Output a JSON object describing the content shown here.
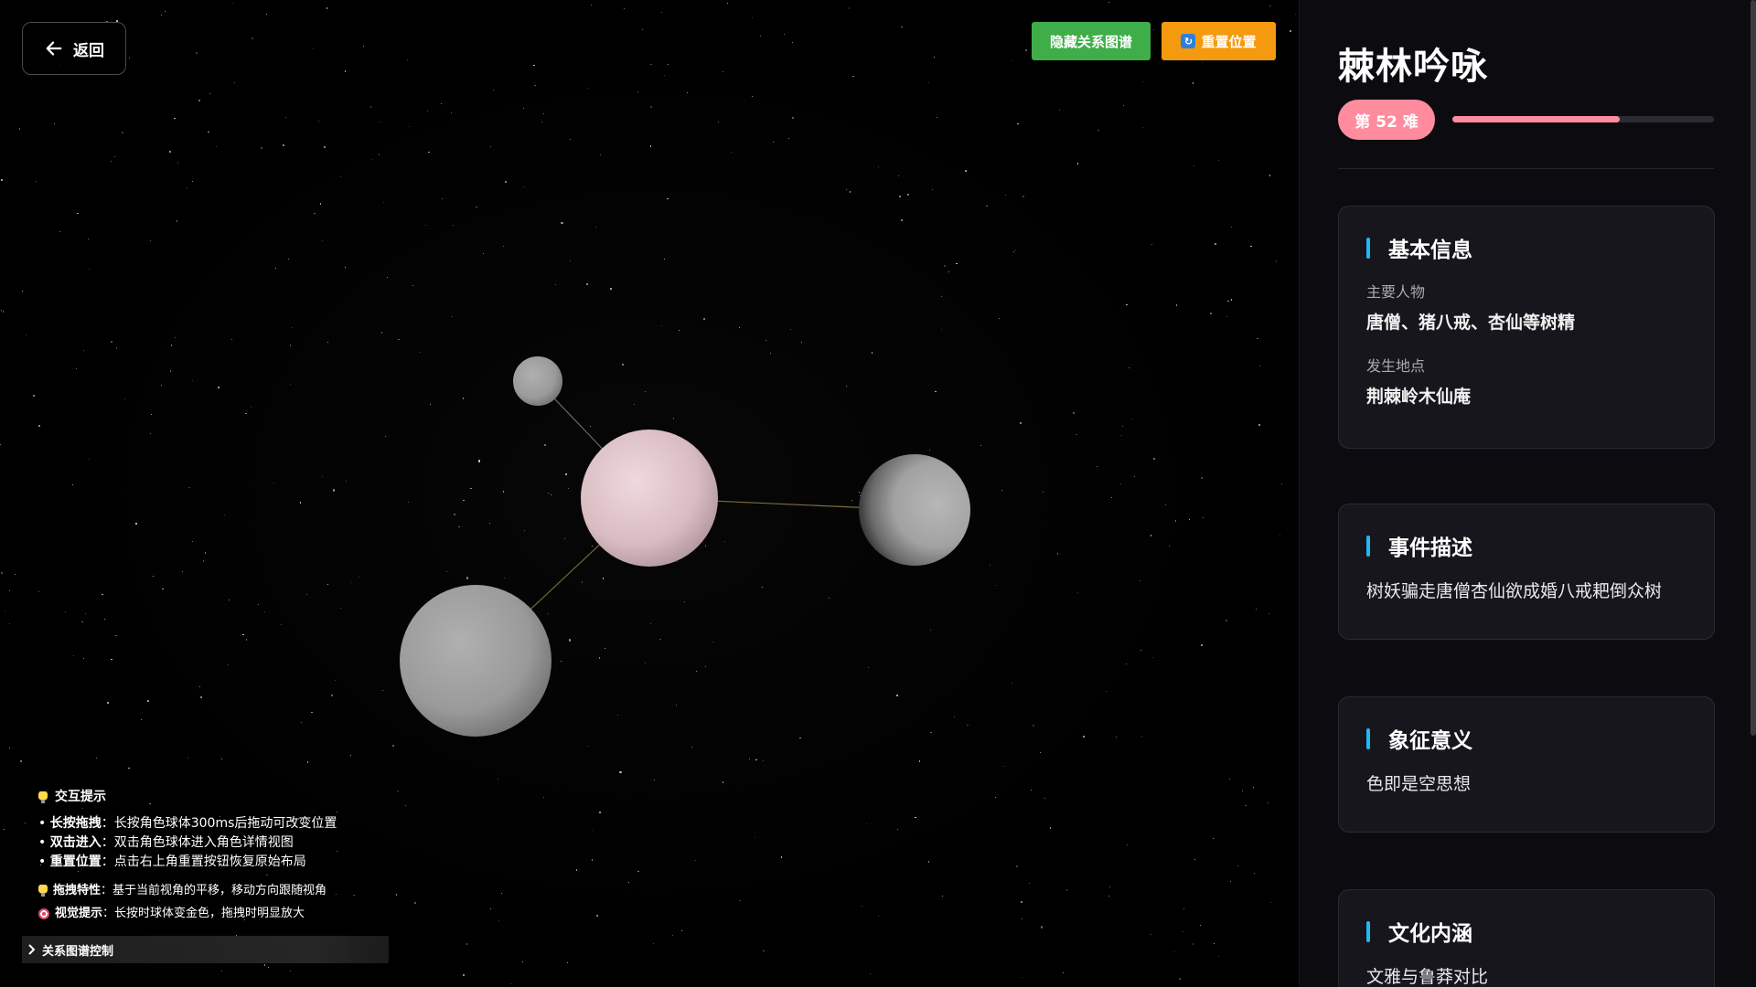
{
  "nav": {
    "back_label": "返回"
  },
  "toolbar": {
    "hide_graph_label": "隐藏关系图谱",
    "reset_label": "重置位置"
  },
  "tips": {
    "title": "交互提示",
    "items": [
      {
        "key": "长按拖拽",
        "text": "：长按角色球体300ms后拖动可改变位置"
      },
      {
        "key": "双击进入",
        "text": "：双击角色球体进入角色详情视图"
      },
      {
        "key": "重置位置",
        "text": "：点击右上角重置按钮恢复原始布局"
      }
    ],
    "extra": [
      {
        "icon": "bulb-icon",
        "key": "拖拽特性",
        "text": "：基于当前视角的平移，移动方向跟随视角"
      },
      {
        "icon": "target-icon",
        "key": "视觉提示",
        "text": "：长按时球体变金色，拖拽时明显放大"
      }
    ],
    "graph_control_label": "关系图谱控制"
  },
  "panel": {
    "title": "棘林吟咏",
    "badge": "第 52 难",
    "progress": 0.64,
    "accent": "#ff8c9e",
    "cards": [
      {
        "title": "基本信息",
        "fields": [
          {
            "label": "主要人物",
            "value": "唐僧、猪八戒、杏仙等树精"
          },
          {
            "label": "发生地点",
            "value": "荆棘岭木仙庵"
          }
        ]
      },
      {
        "title": "事件描述",
        "text": "树妖骗走唐僧杏仙欲成婚八戒耙倒众树"
      },
      {
        "title": "象征意义",
        "text": "色即是空思想"
      },
      {
        "title": "文化内涵",
        "text": "文雅与鲁莽对比"
      }
    ]
  },
  "graph": {
    "nodes": [
      {
        "id": "center",
        "color": "pink"
      },
      {
        "id": "small-top",
        "color": "gray"
      },
      {
        "id": "right",
        "color": "gray"
      },
      {
        "id": "bottom-left",
        "color": "gray"
      }
    ],
    "links": [
      {
        "from": "center",
        "to": "small-top"
      },
      {
        "from": "center",
        "to": "right"
      },
      {
        "from": "center",
        "to": "bottom-left"
      }
    ]
  }
}
